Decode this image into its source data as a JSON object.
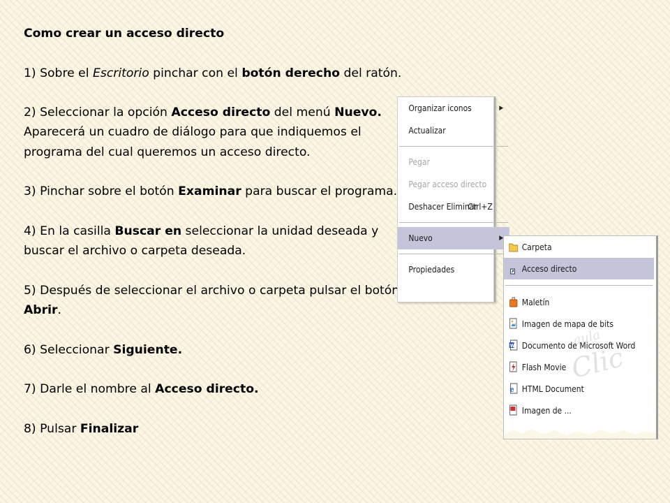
{
  "slide": {
    "title": "Como crear un acceso directo",
    "step1": {
      "num": "1)",
      "a": "Sobre el ",
      "b": "Escritorio",
      "c": " pinchar con el ",
      "d": "botón derecho",
      "e": " del ratón."
    },
    "step2": {
      "num": "2)",
      "a": "Seleccionar la opción ",
      "b": "Acceso directo",
      "c": " del menú ",
      "d": "Nuevo."
    },
    "step2_note": "Aparecerá un cuadro de diálogo para que indiquemos el programa del cual queremos un acceso directo.",
    "step3": {
      "num": "3)",
      "a": "Pinchar sobre el botón ",
      "b": "Examinar",
      "c": " para buscar el programa."
    },
    "step4": {
      "num": "4)",
      "a": "En la casilla ",
      "b": "Buscar en",
      "c": " seleccionar la unidad deseada y buscar el archivo o carpeta deseada."
    },
    "step5": {
      "num": "5)",
      "a": "Después de seleccionar el archivo o carpeta pulsar el botón ",
      "b": "Abrir",
      "c": "."
    },
    "step6": {
      "num": "6)",
      "a": "Seleccionar ",
      "b": "Siguiente."
    },
    "step7": {
      "num": "7)",
      "a": "Darle el nombre al ",
      "b": "Acceso directo."
    },
    "step8": {
      "num": "8)",
      "a": "Pulsar ",
      "b": "Finalizar"
    }
  },
  "context_menu": {
    "items": [
      {
        "label": "Organizar iconos",
        "submenu": true,
        "disabled": false
      },
      {
        "label": "Actualizar",
        "submenu": false,
        "disabled": false
      },
      {
        "label": "Pegar",
        "submenu": false,
        "disabled": true
      },
      {
        "label": "Pegar acceso directo",
        "submenu": false,
        "disabled": true
      },
      {
        "label": "Deshacer Eliminar",
        "shortcut": "Ctrl+Z",
        "disabled": false
      },
      {
        "label": "Nuevo",
        "submenu": true,
        "selected": true,
        "disabled": false
      },
      {
        "label": "Propiedades",
        "submenu": false,
        "disabled": false
      }
    ]
  },
  "submenu": {
    "items": [
      {
        "label": "Carpeta",
        "icon": "folder-icon"
      },
      {
        "label": "Acceso directo",
        "icon": "shortcut-icon",
        "selected": true
      },
      {
        "label": "Maletín",
        "icon": "briefcase-icon"
      },
      {
        "label": "Imagen de mapa de bits",
        "icon": "bitmap-icon"
      },
      {
        "label": "Documento de Microsoft Word",
        "icon": "word-icon"
      },
      {
        "label": "Flash Movie",
        "icon": "flash-icon"
      },
      {
        "label": "HTML Document",
        "icon": "html-icon"
      },
      {
        "label": "Imagen de ...",
        "icon": "image-icon"
      }
    ],
    "watermark_top": "aula",
    "watermark_bottom": "Clic"
  },
  "colors": {
    "selected_bg": "#c4c5db",
    "disabled_text": "#a5a5a5",
    "background": "#fbf6e6"
  }
}
